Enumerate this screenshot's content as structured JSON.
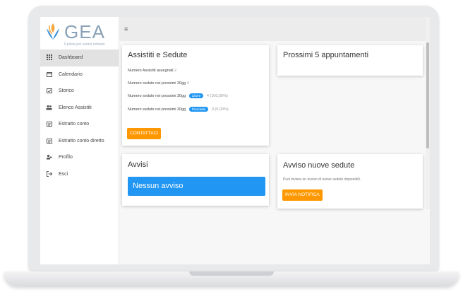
{
  "logo": {
    "text": "GEA",
    "tagline": "Il pilota per animo retinato"
  },
  "nav": [
    {
      "label": "Dashboard",
      "icon": "grid-icon"
    },
    {
      "label": "Calendario",
      "icon": "calendar-icon"
    },
    {
      "label": "Storico",
      "icon": "history-icon"
    },
    {
      "label": "Elenco Assistiti",
      "icon": "people-icon"
    },
    {
      "label": "Estratto conto",
      "icon": "statement-icon"
    },
    {
      "label": "Estratto conto diretto",
      "icon": "statement-direct-icon"
    },
    {
      "label": "Profilo",
      "icon": "profile-icon"
    },
    {
      "label": "Esci",
      "icon": "logout-icon"
    }
  ],
  "topbar": {
    "menu_icon": "≡"
  },
  "assistiti": {
    "title": "Assistiti e Sedute",
    "num_assistiti_label": "Numero Assistiti assegnati",
    "num_assistiti_value": "2",
    "num_sedute_label": "Numero sedute nei prossimi 30gg",
    "num_sedute_value": "4",
    "libere_label": "Numero sedute nei prossimi 30gg",
    "libere_pill": "Libere",
    "libere_value": "4 (100,00%)",
    "prenotate_label": "Numero sedute nei prossimi 30gg",
    "prenotate_pill": "Prenotate",
    "prenotate_value": "0 (0,00%)",
    "button": "CONTATTACI"
  },
  "appuntamenti": {
    "title": "Prossimi 5 appuntamenti"
  },
  "avvisi": {
    "title": "Avvisi",
    "banner": "Nessun avviso"
  },
  "nuove_sedute": {
    "title": "Avviso nuove sedute",
    "text": "Puoi inviare un avviso di nuove sedute disponibili.",
    "button": "INVIA NOTIFICA"
  },
  "colors": {
    "accent": "#2196f3",
    "button": "#ff9800"
  }
}
